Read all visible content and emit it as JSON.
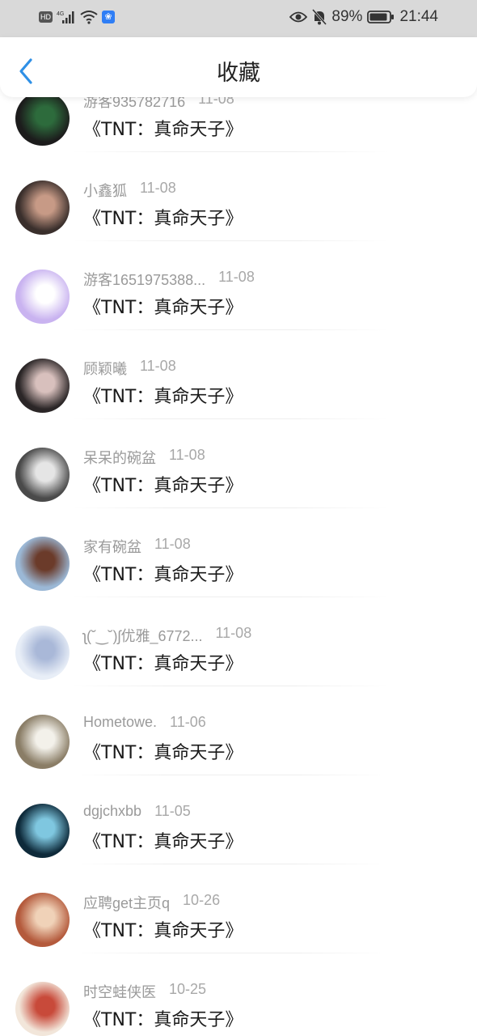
{
  "status_bar": {
    "hd_label": "HD",
    "network_label": "4G",
    "battery_percent": "89%",
    "time": "21:44"
  },
  "header": {
    "title": "收藏"
  },
  "items": [
    {
      "name": "游客935782716",
      "date": "11-08",
      "book": "《TNT：真命天子》",
      "avatar_colors": [
        "#1c1c1c",
        "#2d6b3c"
      ]
    },
    {
      "name": "小鑫狐",
      "date": "11-08",
      "book": "《TNT：真命天子》",
      "avatar_colors": [
        "#3a2f2c",
        "#c79a86"
      ]
    },
    {
      "name": "游客1651975388...",
      "date": "11-08",
      "book": "《TNT：真命天子》",
      "avatar_colors": [
        "#c9b3f0",
        "#ffffff"
      ]
    },
    {
      "name": "顾颖曦",
      "date": "11-08",
      "book": "《TNT：真命天子》",
      "avatar_colors": [
        "#2b2627",
        "#d8c0bd"
      ]
    },
    {
      "name": "呆呆的碗盆",
      "date": "11-08",
      "book": "《TNT：真命天子》",
      "avatar_colors": [
        "#4a4a4a",
        "#e5e5e5"
      ]
    },
    {
      "name": "家有碗盆",
      "date": "11-08",
      "book": "《TNT：真命天子》",
      "avatar_colors": [
        "#9bb8d6",
        "#6b3b2a"
      ]
    },
    {
      "name": "ʅ(˘‿˘)ʃ优雅_6772...",
      "date": "11-08",
      "book": "《TNT：真命天子》",
      "avatar_colors": [
        "#e8eef7",
        "#a9b8d8"
      ]
    },
    {
      "name": "Hometowe.",
      "date": "11-06",
      "book": "《TNT：真命天子》",
      "avatar_colors": [
        "#8a7d66",
        "#f3f1ea"
      ]
    },
    {
      "name": "dgjchxbb",
      "date": "11-05",
      "book": "《TNT：真命天子》",
      "avatar_colors": [
        "#0e2a3a",
        "#7fc7e0"
      ]
    },
    {
      "name": "应聘get主页q",
      "date": "10-26",
      "book": "《TNT：真命天子》",
      "avatar_colors": [
        "#b45a3c",
        "#f0d2b8"
      ]
    },
    {
      "name": "时空蛙侠医",
      "date": "10-25",
      "book": "《TNT：真命天子》",
      "avatar_colors": [
        "#f2e6da",
        "#c84a3a"
      ]
    }
  ]
}
